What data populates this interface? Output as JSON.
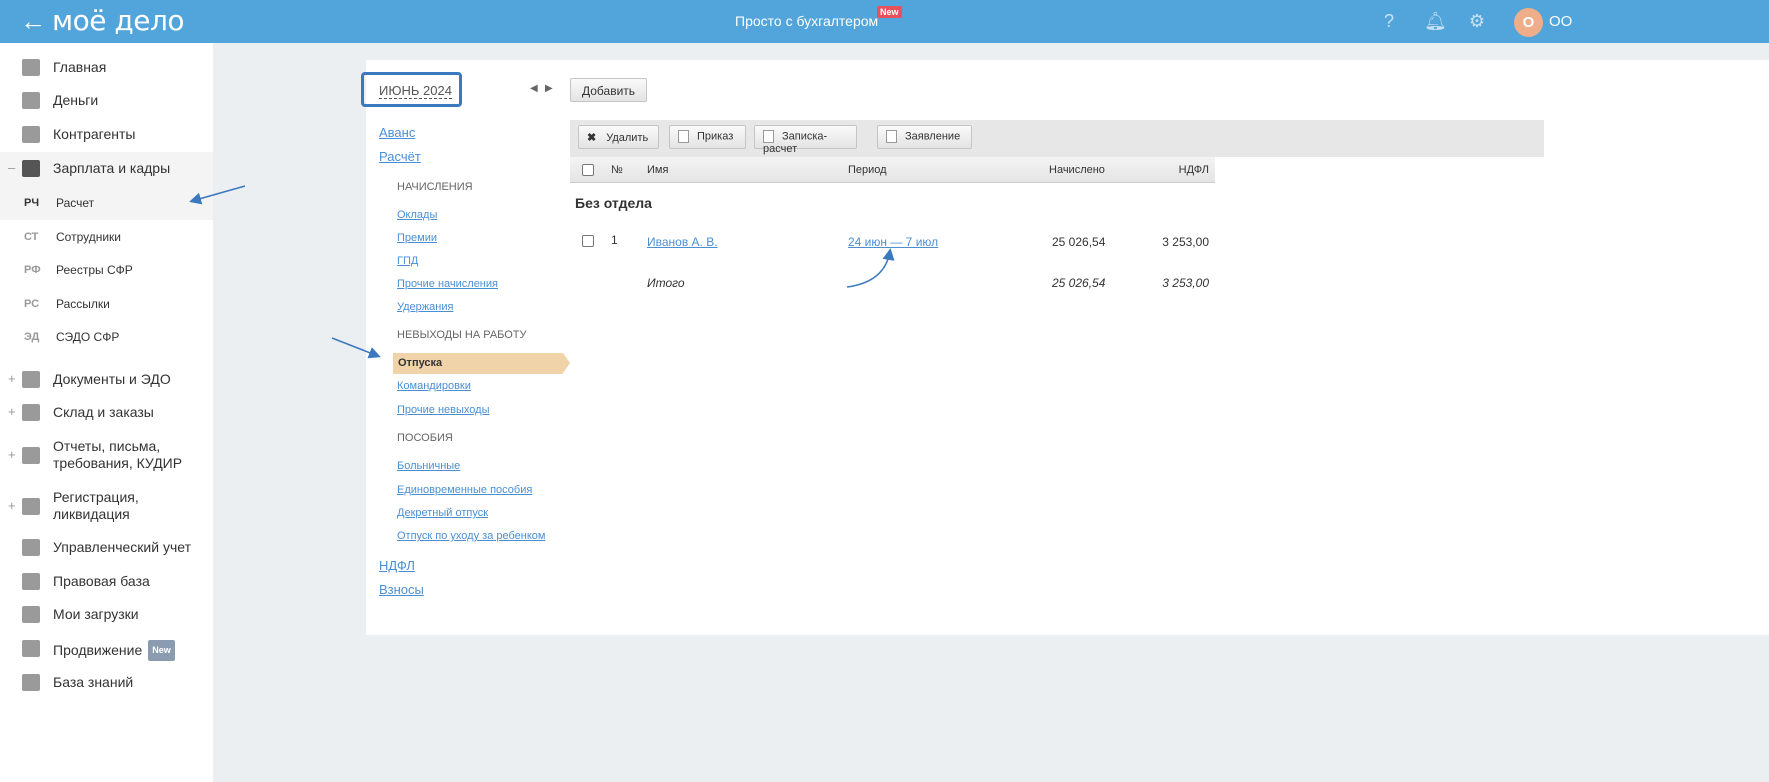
{
  "header": {
    "logo": "моё дело",
    "center": "Просто с бухгалтером",
    "new_badge": "New",
    "avatar": "О",
    "org": "ОО"
  },
  "sidebar": {
    "items": [
      {
        "label": "Главная",
        "icon": "home-icon"
      },
      {
        "label": "Деньги",
        "icon": "money-icon"
      },
      {
        "label": "Контрагенты",
        "icon": "contractor-icon"
      },
      {
        "label": "Зарплата и кадры",
        "icon": "wallet-icon",
        "toggle": "–"
      },
      {
        "label": "Документы и ЭДО",
        "icon": "folder-icon",
        "toggle": "+"
      },
      {
        "label": "Склад и заказы",
        "icon": "warehouse-icon",
        "toggle": "+"
      },
      {
        "label": "Отчеты, письма, требования, КУДИР",
        "icon": "report-icon",
        "toggle": "+"
      },
      {
        "label": "Регистрация, ликвидация",
        "icon": "registration-icon",
        "toggle": "+"
      },
      {
        "label": "Управленческий учет",
        "icon": "ruble-icon"
      },
      {
        "label": "Правовая база",
        "icon": "briefcase-icon"
      },
      {
        "label": "Мои загрузки",
        "icon": "folder-icon"
      },
      {
        "label": "Продвижение",
        "icon": "chart-icon",
        "badge": "New"
      },
      {
        "label": "База знаний",
        "icon": "graduation-icon"
      }
    ],
    "subitems": [
      {
        "abbr": "РЧ",
        "label": "Расчет"
      },
      {
        "abbr": "СТ",
        "label": "Сотрудники"
      },
      {
        "abbr": "РФ",
        "label": "Реестры СФР"
      },
      {
        "abbr": "РС",
        "label": "Рассылки"
      },
      {
        "abbr": "ЭД",
        "label": "СЭДО СФР"
      }
    ]
  },
  "period": "ИЮНЬ 2024",
  "add_button": "Добавить",
  "nav": {
    "avans": "Аванс",
    "raschet": "Расчёт",
    "sec1": "НАЧИСЛЕНИЯ",
    "s1": [
      "Оклады",
      "Премии",
      "ГПД",
      "Прочие начисления",
      "Удержания"
    ],
    "sec2": "НЕВЫХОДЫ НА РАБОТУ",
    "selected": "Отпуска",
    "s2": [
      "Командировки",
      "Прочие невыходы"
    ],
    "sec3": "ПОСОБИЯ",
    "s3": [
      "Больничные",
      "Единовременные пособия",
      "Декретный отпуск",
      "Отпуск по уходу за ребенком"
    ],
    "ndfl": "НДФЛ",
    "vznosy": "Взносы"
  },
  "toolbar": {
    "delete": "Удалить",
    "order": "Приказ",
    "note": "Записка-расчет",
    "statement": "Заявление"
  },
  "table": {
    "headers": {
      "num": "№",
      "name": "Имя",
      "period": "Период",
      "accrued": "Начислено",
      "ndfl": "НДФЛ"
    },
    "group": "Без отдела",
    "rows": [
      {
        "num": "1",
        "name": "Иванов А. В.",
        "period": "24 июн — 7 июл",
        "accrued": "25 026,54",
        "ndfl": "3 253,00"
      }
    ],
    "total": {
      "label": "Итого",
      "accrued": "25 026,54",
      "ndfl": "3 253,00"
    }
  }
}
